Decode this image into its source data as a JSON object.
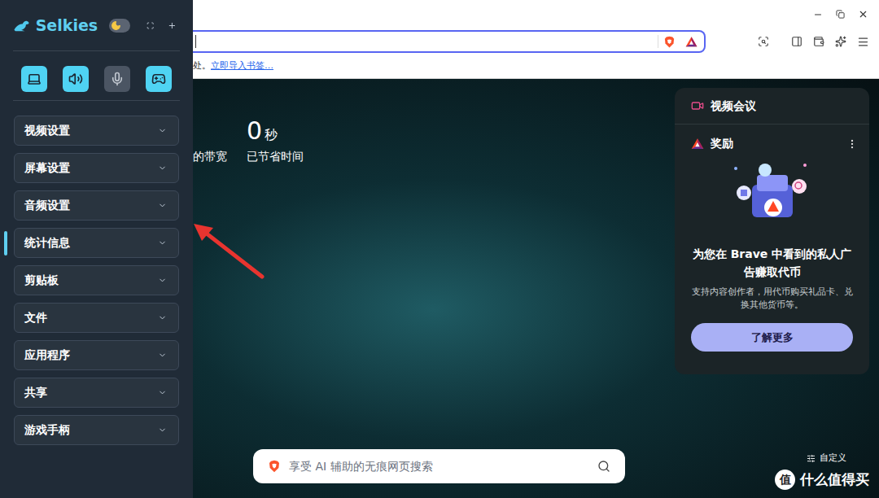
{
  "sidebar": {
    "title": "Selkies",
    "dark_mode": true,
    "modes": [
      {
        "kind": "display",
        "on": true
      },
      {
        "kind": "speaker",
        "on": true
      },
      {
        "kind": "microphone",
        "on": false
      },
      {
        "kind": "gamepad",
        "on": true
      }
    ],
    "sections": [
      {
        "label": "视频设置",
        "selected": false,
        "expanded": false
      },
      {
        "label": "屏幕设置",
        "selected": false,
        "expanded": false
      },
      {
        "label": "音频设置",
        "selected": false,
        "expanded": false
      },
      {
        "label": "统计信息",
        "selected": true,
        "expanded": false
      },
      {
        "label": "剪贴板",
        "selected": false,
        "expanded": false
      },
      {
        "label": "文件",
        "selected": false,
        "expanded": false
      },
      {
        "label": "应用程序",
        "selected": false,
        "expanded": false
      },
      {
        "label": "共享",
        "selected": false,
        "expanded": false
      },
      {
        "label": "游戏手柄",
        "selected": false,
        "expanded": false
      }
    ]
  },
  "browser": {
    "bookmarks_bar": {
      "text": "处。",
      "link": "立即导入书签…"
    },
    "stats": [
      {
        "label": "的带宽"
      },
      {
        "value": "0",
        "unit": "秒",
        "label": "已节省时间"
      }
    ],
    "widget": {
      "title": "视频会议"
    },
    "rewards": {
      "title": "奖励",
      "headline": "为您在 Brave 中看到的私人广告赚取代币",
      "description": "支持内容创作者，用代币购买礼品卡、兑换其他货币等。",
      "button": "了解更多"
    },
    "search": {
      "placeholder": "享受 AI 辅助的无痕网页搜索"
    },
    "customize": "自定义"
  },
  "watermark": {
    "badge": "值",
    "text": "什么值得买"
  }
}
